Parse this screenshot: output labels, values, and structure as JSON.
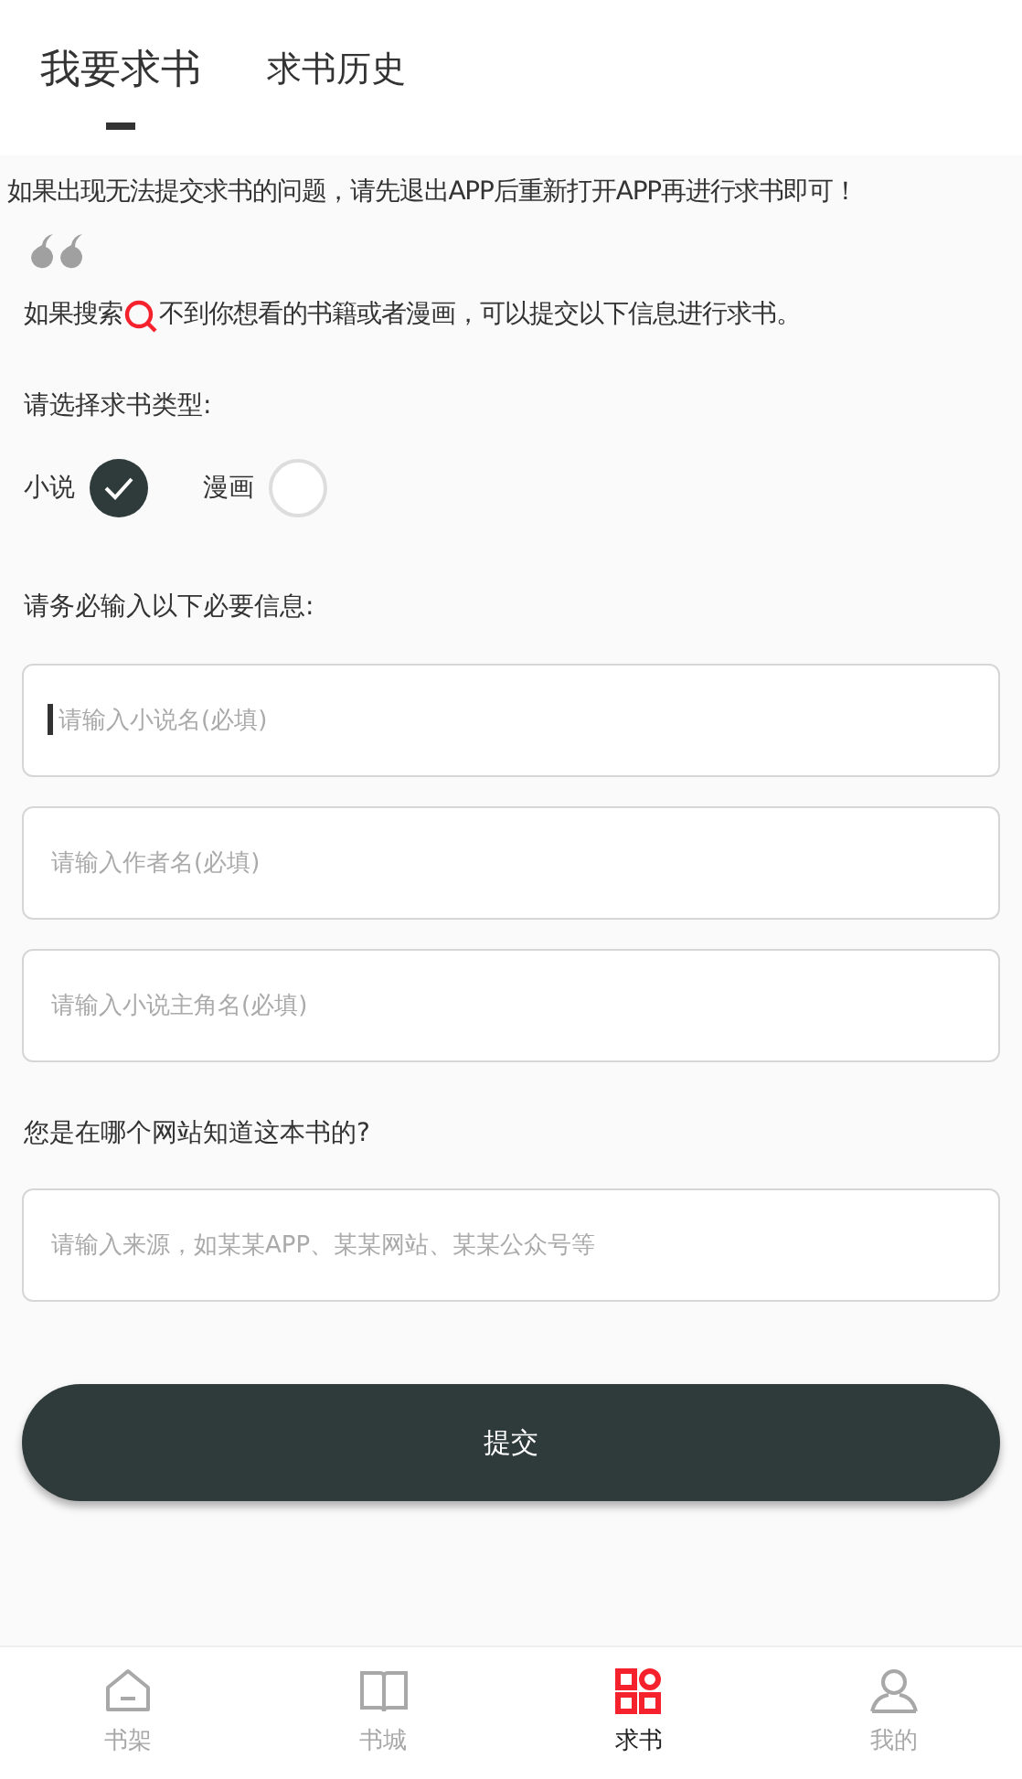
{
  "tabs": [
    {
      "label": "我要求书",
      "selected": true
    },
    {
      "label": "求书历史",
      "selected": false
    }
  ],
  "notice": "如果出现无法提交求书的问题，请先退出APP后重新打开APP再进行求书即可！",
  "intro": {
    "before": "如果搜索",
    "after": "不到你想看的书籍或者漫画，可以提交以下信息进行求书。"
  },
  "type_prompt": "请选择求书类型:",
  "types": [
    {
      "label": "小说",
      "selected": true
    },
    {
      "label": "漫画",
      "selected": false
    }
  ],
  "info_prompt": "请务必输入以下必要信息:",
  "fields": [
    {
      "placeholder": "请输入小说名(必填)",
      "focused": true
    },
    {
      "placeholder": "请输入作者名(必填)",
      "focused": false
    },
    {
      "placeholder": "请输入小说主角名(必填)",
      "focused": false
    }
  ],
  "source_prompt": "您是在哪个网站知道这本书的?",
  "source_field": {
    "placeholder": "请输入来源，如某某APP、某某网站、某某公众号等"
  },
  "submit": "提交",
  "nav": [
    {
      "label": "书架",
      "selected": false
    },
    {
      "label": "书城",
      "selected": false
    },
    {
      "label": "求书",
      "selected": true
    },
    {
      "label": "我的",
      "selected": false
    }
  ]
}
